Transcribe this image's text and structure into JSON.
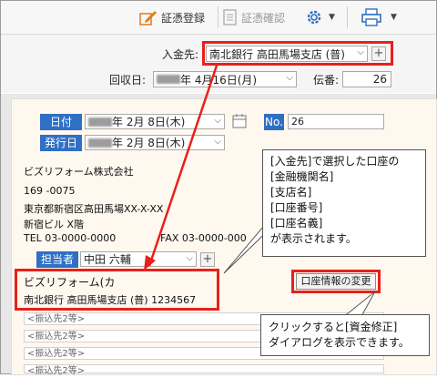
{
  "toolbar": {
    "register_label": "証憑登録",
    "confirm_label": "証憑確認"
  },
  "deposit": {
    "label": "入金先:",
    "value": "南北銀行 高田馬場支店 (普)"
  },
  "collection": {
    "label": "回収日:",
    "date_value": "年 4月16日(月)",
    "slip_label": "伝番:",
    "slip_value": "26"
  },
  "doc": {
    "date_label": "日付",
    "date_value": "年 2月 8日(木)",
    "no_label": "No.",
    "no_value": "26",
    "issue_label": "発行日",
    "issue_value": "年 2月 8日(木)",
    "company": "ビズリフォーム株式会社",
    "postal": "169 -0075",
    "address1": "東京都新宿区高田馬場XX-X-XX",
    "address2": "新宿ビル X階",
    "tel": "TEL 03-0000-0000",
    "fax": "FAX 03-0000-000",
    "person_label": "担当者",
    "person_value": "中田 六輔",
    "account_name": "ビズリフォーム(カ",
    "account_detail": "南北銀行 高田馬場支店 (普) 1234567",
    "change_button": "口座情報の変更",
    "transfer_lines": [
      "<振込先2等>",
      "<振込先2等>",
      "<振込先2等>",
      "<振込先2等>"
    ]
  },
  "callout1": {
    "lines": [
      "[入金先]で選択した口座の",
      "[金融機関名]",
      "[支店名]",
      "[口座番号]",
      "[口座名義]",
      "が表示されます。"
    ]
  },
  "callout2": {
    "lines": [
      "クリックすると[資金修正]",
      "ダイアログを表示できます。"
    ]
  },
  "colors": {
    "accent": "#2f6fc4",
    "highlight": "#e8201b",
    "paper": "#fff8ef"
  }
}
